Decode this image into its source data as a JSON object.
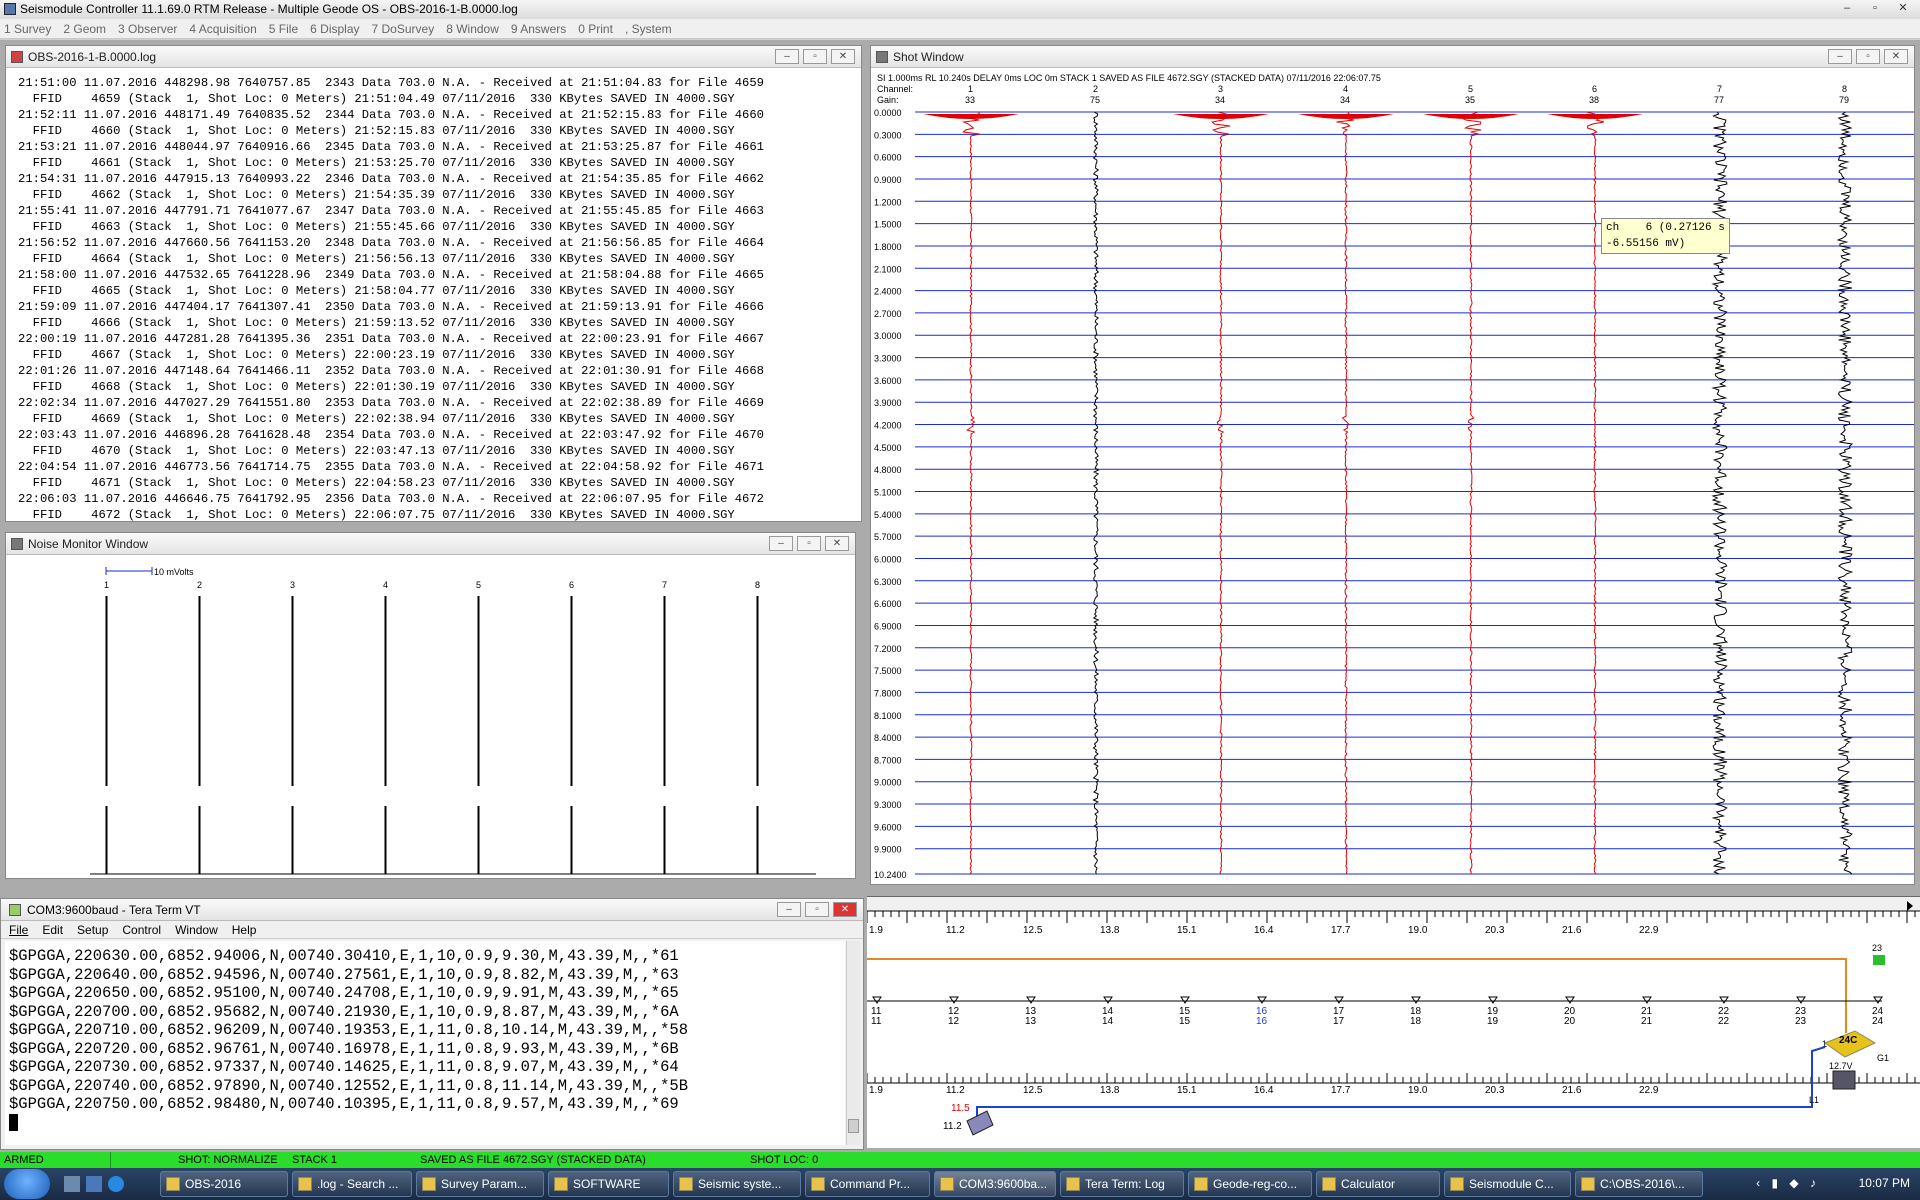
{
  "app": {
    "title": "Seismodule Controller 11.1.69.0 RTM Release - Multiple Geode OS - OBS-2016-1-B.0000.log",
    "window_buttons": [
      "–",
      "▫",
      "✕"
    ]
  },
  "menu": [
    "1 Survey",
    "2 Geom",
    "3 Observer",
    "4 Acquisition",
    "5 File",
    "6 Display",
    "7 DoSurvey",
    "8 Window",
    "9 Answers",
    "0 Print",
    ", System"
  ],
  "log_window": {
    "title": "OBS-2016-1-B.0000.log",
    "lines": [
      "21:51:00 11.07.2016 448298.98 7640757.85  2343 Data 703.0 N.A. - Received at 21:51:04.83 for File 4659",
      "  FFID    4659 (Stack  1, Shot Loc: 0 Meters) 21:51:04.49 07/11/2016  330 KBytes SAVED IN 4000.SGY",
      "21:52:11 11.07.2016 448171.49 7640835.52  2344 Data 703.0 N.A. - Received at 21:52:15.83 for File 4660",
      "  FFID    4660 (Stack  1, Shot Loc: 0 Meters) 21:52:15.83 07/11/2016  330 KBytes SAVED IN 4000.SGY",
      "21:53:21 11.07.2016 448044.97 7640916.66  2345 Data 703.0 N.A. - Received at 21:53:25.87 for File 4661",
      "  FFID    4661 (Stack  1, Shot Loc: 0 Meters) 21:53:25.70 07/11/2016  330 KBytes SAVED IN 4000.SGY",
      "21:54:31 11.07.2016 447915.13 7640993.22  2346 Data 703.0 N.A. - Received at 21:54:35.85 for File 4662",
      "  FFID    4662 (Stack  1, Shot Loc: 0 Meters) 21:54:35.39 07/11/2016  330 KBytes SAVED IN 4000.SGY",
      "21:55:41 11.07.2016 447791.71 7641077.67  2347 Data 703.0 N.A. - Received at 21:55:45.85 for File 4663",
      "  FFID    4663 (Stack  1, Shot Loc: 0 Meters) 21:55:45.66 07/11/2016  330 KBytes SAVED IN 4000.SGY",
      "21:56:52 11.07.2016 447660.56 7641153.20  2348 Data 703.0 N.A. - Received at 21:56:56.85 for File 4664",
      "  FFID    4664 (Stack  1, Shot Loc: 0 Meters) 21:56:56.13 07/11/2016  330 KBytes SAVED IN 4000.SGY",
      "21:58:00 11.07.2016 447532.65 7641228.96  2349 Data 703.0 N.A. - Received at 21:58:04.88 for File 4665",
      "  FFID    4665 (Stack  1, Shot Loc: 0 Meters) 21:58:04.77 07/11/2016  330 KBytes SAVED IN 4000.SGY",
      "21:59:09 11.07.2016 447404.17 7641307.41  2350 Data 703.0 N.A. - Received at 21:59:13.91 for File 4666",
      "  FFID    4666 (Stack  1, Shot Loc: 0 Meters) 21:59:13.52 07/11/2016  330 KBytes SAVED IN 4000.SGY",
      "22:00:19 11.07.2016 447281.28 7641395.36  2351 Data 703.0 N.A. - Received at 22:00:23.91 for File 4667",
      "  FFID    4667 (Stack  1, Shot Loc: 0 Meters) 22:00:23.19 07/11/2016  330 KBytes SAVED IN 4000.SGY",
      "22:01:26 11.07.2016 447148.64 7641466.11  2352 Data 703.0 N.A. - Received at 22:01:30.91 for File 4668",
      "  FFID    4668 (Stack  1, Shot Loc: 0 Meters) 22:01:30.19 07/11/2016  330 KBytes SAVED IN 4000.SGY",
      "22:02:34 11.07.2016 447027.29 7641551.80  2353 Data 703.0 N.A. - Received at 22:02:38.89 for File 4669",
      "  FFID    4669 (Stack  1, Shot Loc: 0 Meters) 22:02:38.94 07/11/2016  330 KBytes SAVED IN 4000.SGY",
      "22:03:43 11.07.2016 446896.28 7641628.48  2354 Data 703.0 N.A. - Received at 22:03:47.92 for File 4670",
      "  FFID    4670 (Stack  1, Shot Loc: 0 Meters) 22:03:47.13 07/11/2016  330 KBytes SAVED IN 4000.SGY",
      "22:04:54 11.07.2016 446773.56 7641714.75  2355 Data 703.0 N.A. - Received at 22:04:58.92 for File 4671",
      "  FFID    4671 (Stack  1, Shot Loc: 0 Meters) 22:04:58.23 07/11/2016  330 KBytes SAVED IN 4000.SGY",
      "22:06:03 11.07.2016 446646.75 7641792.95  2356 Data 703.0 N.A. - Received at 22:06:07.95 for File 4672",
      "  FFID    4672 (Stack  1, Shot Loc: 0 Meters) 22:06:07.75 07/11/2016  330 KBytes SAVED IN 4000.SGY"
    ]
  },
  "noise_window": {
    "title": "Noise Monitor Window",
    "scale_label": "10 mVolts",
    "channels": [
      "1",
      "2",
      "3",
      "4",
      "5",
      "6",
      "7",
      "8"
    ]
  },
  "shot_window": {
    "title": "Shot Window",
    "header": "SI 1.000ms   RL 10.240s   DELAY 0ms   LOC 0m   STACK 1   SAVED AS FILE 4672.SGY (STACKED DATA)   07/11/2016 22:06:07.75",
    "channel_label": "Channel:",
    "gain_label": "Gain:",
    "channels": [
      "1",
      "2",
      "3",
      "4",
      "5",
      "6",
      "7",
      "8"
    ],
    "gains": [
      "33",
      "75",
      "34",
      "34",
      "35",
      "38",
      "77",
      "79"
    ],
    "time_labels": [
      "0.0000",
      "0.3000",
      "0.6000",
      "0.9000",
      "1.2000",
      "1.5000",
      "1.8000",
      "2.1000",
      "2.4000",
      "2.7000",
      "3.0000",
      "3.3000",
      "3.6000",
      "3.9000",
      "4.2000",
      "4.5000",
      "4.8000",
      "5.1000",
      "5.4000",
      "5.7000",
      "6.0000",
      "6.3000",
      "6.6000",
      "6.9000",
      "7.2000",
      "7.5000",
      "7.8000",
      "8.1000",
      "8.4000",
      "8.7000",
      "9.0000",
      "9.3000",
      "9.6000",
      "9.9000",
      "10.2400"
    ],
    "tooltip_line1": "ch    6 (0.27126 s",
    "tooltip_line2": "-6.55156 mV)",
    "trace_colors": [
      "#e00000",
      "#000000",
      "#e00000",
      "#e00000",
      "#e00000",
      "#e00000",
      "#000000",
      "#000000"
    ],
    "grid_color": "#1a2bd0"
  },
  "tera_term": {
    "title": "COM3:9600baud - Tera Term VT",
    "menu": [
      "File",
      "Edit",
      "Setup",
      "Control",
      "Window",
      "Help"
    ],
    "lines": [
      "$GPGGA,220630.00,6852.94006,N,00740.30410,E,1,10,0.9,9.30,M,43.39,M,,*61",
      "$GPGGA,220640.00,6852.94596,N,00740.27561,E,1,10,0.9,8.82,M,43.39,M,,*63",
      "$GPGGA,220650.00,6852.95100,N,00740.24708,E,1,10,0.9,9.91,M,43.39,M,,*65",
      "$GPGGA,220700.00,6852.95682,N,00740.21930,E,1,10,0.9,8.87,M,43.39,M,,*6A",
      "$GPGGA,220710.00,6852.96209,N,00740.19353,E,1,11,0.8,10.14,M,43.39,M,,*58",
      "$GPGGA,220720.00,6852.96761,N,00740.16978,E,1,11,0.8,9.93,M,43.39,M,,*6B",
      "$GPGGA,220730.00,6852.97337,N,00740.14625,E,1,11,0.8,9.07,M,43.39,M,,*64",
      "$GPGGA,220740.00,6852.97890,N,00740.12552,E,1,11,0.8,11.14,M,43.39,M,,*5B",
      "$GPGGA,220750.00,6852.98480,N,00740.10395,E,1,11,0.8,9.57,M,43.39,M,,*69"
    ]
  },
  "layout_view": {
    "ruler_labels": [
      "1.9",
      "11.2",
      "12.5",
      "13.8",
      "15.1",
      "16.4",
      "17.7",
      "19.0",
      "20.3",
      "21.6",
      "22.9"
    ],
    "station_labels": [
      "11",
      "12",
      "13",
      "14",
      "15",
      "16",
      "17",
      "18",
      "19",
      "20",
      "21",
      "22",
      "23",
      "24"
    ],
    "highlight_station": "16",
    "geode_label": "24C",
    "geode_side_label": "G1",
    "battery_label": "12.7V",
    "laptop_pos_label": "11.5",
    "laptop_station_label": "11.2",
    "line_label": "L1",
    "end_label": "23",
    "station_1_label": "1",
    "line_color": "#1f3fd0",
    "wire_color": "#e08a1f"
  },
  "status_bar": {
    "armed": "ARMED",
    "shot": "SHOT: NORMALIZE",
    "stack": "STACK 1",
    "saved": "SAVED AS FILE 4672.SGY (STACKED DATA)",
    "shot_loc": "SHOT LOC: 0"
  },
  "taskbar": {
    "items": [
      "OBS-2016",
      ".log - Search ...",
      "Survey Param...",
      "SOFTWARE",
      "Seismic syste...",
      "Command Pr...",
      "COM3:9600ba...",
      "Tera Term: Log",
      "Geode-reg-co...",
      "Calculator",
      "Seismodule C...",
      "C:\\OBS-2016\\..."
    ],
    "clock": "10:07 PM"
  }
}
